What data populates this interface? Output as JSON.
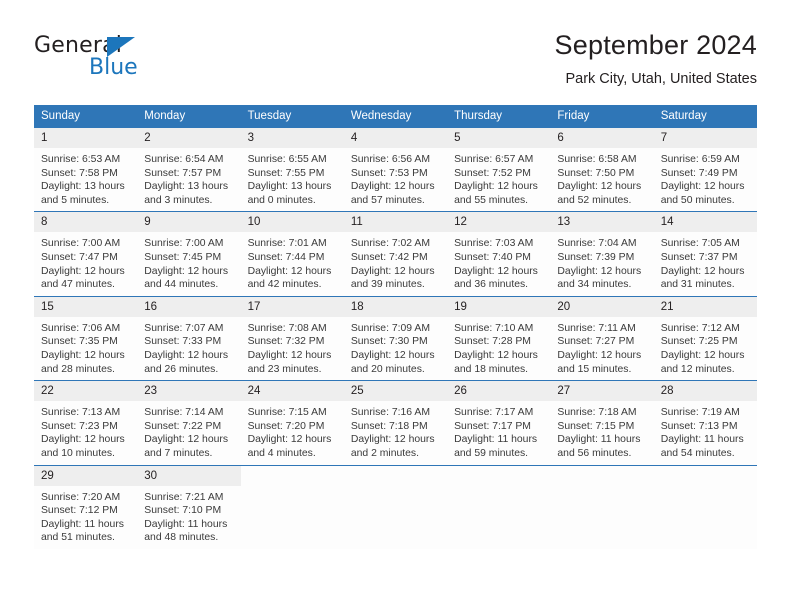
{
  "brand": {
    "name_top": "General",
    "name_bottom": "Blue",
    "accent_color": "#1c76bc"
  },
  "header": {
    "title": "September 2024",
    "subtitle": "Park City, Utah, United States"
  },
  "theme": {
    "header_blue": "#2f76b7",
    "daynum_gray": "#eeeeee"
  },
  "calendar": {
    "weekdays": [
      "Sunday",
      "Monday",
      "Tuesday",
      "Wednesday",
      "Thursday",
      "Friday",
      "Saturday"
    ],
    "labels": {
      "sunrise": "Sunrise:",
      "sunset": "Sunset:",
      "daylight": "Daylight:"
    },
    "weeks": [
      [
        {
          "day": "1",
          "sunrise": "Sunrise: 6:53 AM",
          "sunset": "Sunset: 7:58 PM",
          "daylight": "Daylight: 13 hours and 5 minutes."
        },
        {
          "day": "2",
          "sunrise": "Sunrise: 6:54 AM",
          "sunset": "Sunset: 7:57 PM",
          "daylight": "Daylight: 13 hours and 3 minutes."
        },
        {
          "day": "3",
          "sunrise": "Sunrise: 6:55 AM",
          "sunset": "Sunset: 7:55 PM",
          "daylight": "Daylight: 13 hours and 0 minutes."
        },
        {
          "day": "4",
          "sunrise": "Sunrise: 6:56 AM",
          "sunset": "Sunset: 7:53 PM",
          "daylight": "Daylight: 12 hours and 57 minutes."
        },
        {
          "day": "5",
          "sunrise": "Sunrise: 6:57 AM",
          "sunset": "Sunset: 7:52 PM",
          "daylight": "Daylight: 12 hours and 55 minutes."
        },
        {
          "day": "6",
          "sunrise": "Sunrise: 6:58 AM",
          "sunset": "Sunset: 7:50 PM",
          "daylight": "Daylight: 12 hours and 52 minutes."
        },
        {
          "day": "7",
          "sunrise": "Sunrise: 6:59 AM",
          "sunset": "Sunset: 7:49 PM",
          "daylight": "Daylight: 12 hours and 50 minutes."
        }
      ],
      [
        {
          "day": "8",
          "sunrise": "Sunrise: 7:00 AM",
          "sunset": "Sunset: 7:47 PM",
          "daylight": "Daylight: 12 hours and 47 minutes."
        },
        {
          "day": "9",
          "sunrise": "Sunrise: 7:00 AM",
          "sunset": "Sunset: 7:45 PM",
          "daylight": "Daylight: 12 hours and 44 minutes."
        },
        {
          "day": "10",
          "sunrise": "Sunrise: 7:01 AM",
          "sunset": "Sunset: 7:44 PM",
          "daylight": "Daylight: 12 hours and 42 minutes."
        },
        {
          "day": "11",
          "sunrise": "Sunrise: 7:02 AM",
          "sunset": "Sunset: 7:42 PM",
          "daylight": "Daylight: 12 hours and 39 minutes."
        },
        {
          "day": "12",
          "sunrise": "Sunrise: 7:03 AM",
          "sunset": "Sunset: 7:40 PM",
          "daylight": "Daylight: 12 hours and 36 minutes."
        },
        {
          "day": "13",
          "sunrise": "Sunrise: 7:04 AM",
          "sunset": "Sunset: 7:39 PM",
          "daylight": "Daylight: 12 hours and 34 minutes."
        },
        {
          "day": "14",
          "sunrise": "Sunrise: 7:05 AM",
          "sunset": "Sunset: 7:37 PM",
          "daylight": "Daylight: 12 hours and 31 minutes."
        }
      ],
      [
        {
          "day": "15",
          "sunrise": "Sunrise: 7:06 AM",
          "sunset": "Sunset: 7:35 PM",
          "daylight": "Daylight: 12 hours and 28 minutes."
        },
        {
          "day": "16",
          "sunrise": "Sunrise: 7:07 AM",
          "sunset": "Sunset: 7:33 PM",
          "daylight": "Daylight: 12 hours and 26 minutes."
        },
        {
          "day": "17",
          "sunrise": "Sunrise: 7:08 AM",
          "sunset": "Sunset: 7:32 PM",
          "daylight": "Daylight: 12 hours and 23 minutes."
        },
        {
          "day": "18",
          "sunrise": "Sunrise: 7:09 AM",
          "sunset": "Sunset: 7:30 PM",
          "daylight": "Daylight: 12 hours and 20 minutes."
        },
        {
          "day": "19",
          "sunrise": "Sunrise: 7:10 AM",
          "sunset": "Sunset: 7:28 PM",
          "daylight": "Daylight: 12 hours and 18 minutes."
        },
        {
          "day": "20",
          "sunrise": "Sunrise: 7:11 AM",
          "sunset": "Sunset: 7:27 PM",
          "daylight": "Daylight: 12 hours and 15 minutes."
        },
        {
          "day": "21",
          "sunrise": "Sunrise: 7:12 AM",
          "sunset": "Sunset: 7:25 PM",
          "daylight": "Daylight: 12 hours and 12 minutes."
        }
      ],
      [
        {
          "day": "22",
          "sunrise": "Sunrise: 7:13 AM",
          "sunset": "Sunset: 7:23 PM",
          "daylight": "Daylight: 12 hours and 10 minutes."
        },
        {
          "day": "23",
          "sunrise": "Sunrise: 7:14 AM",
          "sunset": "Sunset: 7:22 PM",
          "daylight": "Daylight: 12 hours and 7 minutes."
        },
        {
          "day": "24",
          "sunrise": "Sunrise: 7:15 AM",
          "sunset": "Sunset: 7:20 PM",
          "daylight": "Daylight: 12 hours and 4 minutes."
        },
        {
          "day": "25",
          "sunrise": "Sunrise: 7:16 AM",
          "sunset": "Sunset: 7:18 PM",
          "daylight": "Daylight: 12 hours and 2 minutes."
        },
        {
          "day": "26",
          "sunrise": "Sunrise: 7:17 AM",
          "sunset": "Sunset: 7:17 PM",
          "daylight": "Daylight: 11 hours and 59 minutes."
        },
        {
          "day": "27",
          "sunrise": "Sunrise: 7:18 AM",
          "sunset": "Sunset: 7:15 PM",
          "daylight": "Daylight: 11 hours and 56 minutes."
        },
        {
          "day": "28",
          "sunrise": "Sunrise: 7:19 AM",
          "sunset": "Sunset: 7:13 PM",
          "daylight": "Daylight: 11 hours and 54 minutes."
        }
      ],
      [
        {
          "day": "29",
          "sunrise": "Sunrise: 7:20 AM",
          "sunset": "Sunset: 7:12 PM",
          "daylight": "Daylight: 11 hours and 51 minutes."
        },
        {
          "day": "30",
          "sunrise": "Sunrise: 7:21 AM",
          "sunset": "Sunset: 7:10 PM",
          "daylight": "Daylight: 11 hours and 48 minutes."
        },
        {
          "day": "",
          "sunrise": "",
          "sunset": "",
          "daylight": ""
        },
        {
          "day": "",
          "sunrise": "",
          "sunset": "",
          "daylight": ""
        },
        {
          "day": "",
          "sunrise": "",
          "sunset": "",
          "daylight": ""
        },
        {
          "day": "",
          "sunrise": "",
          "sunset": "",
          "daylight": ""
        },
        {
          "day": "",
          "sunrise": "",
          "sunset": "",
          "daylight": ""
        }
      ]
    ]
  }
}
